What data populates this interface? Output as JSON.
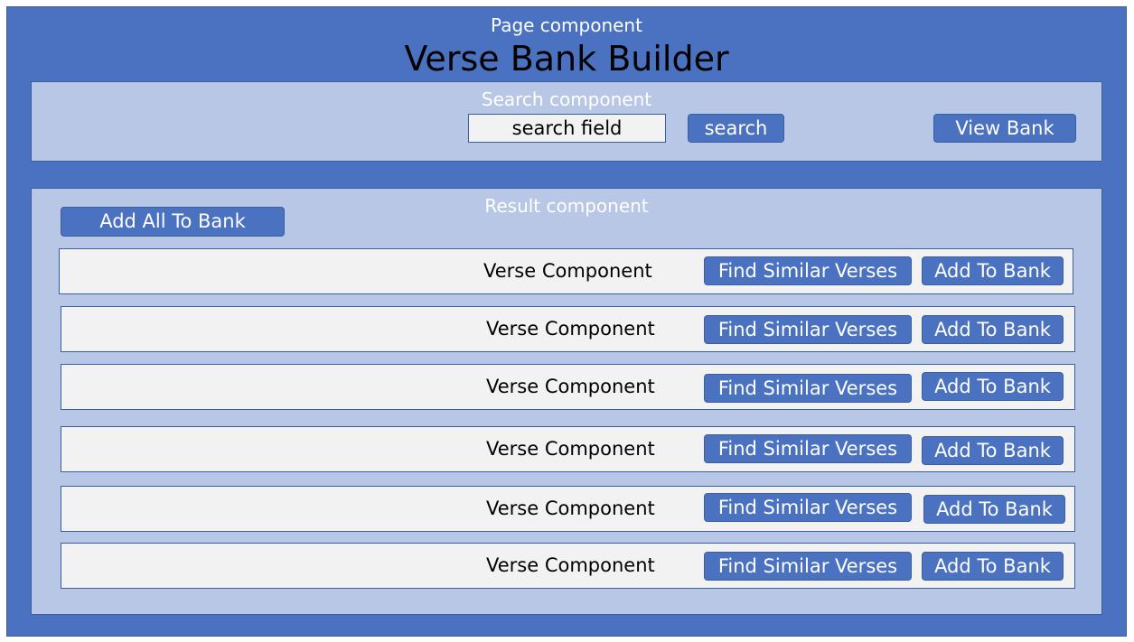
{
  "page": {
    "label": "Page component",
    "title": "Verse Bank Builder"
  },
  "search": {
    "label": "Search component",
    "field_text": "search field",
    "search_button": "search",
    "view_bank_button": "View Bank"
  },
  "result": {
    "label": "Result component",
    "add_all_button": "Add All To Bank",
    "verses": [
      {
        "label": "Verse Component",
        "find_similar": "Find Similar Verses",
        "add": "Add To Bank"
      },
      {
        "label": "Verse Component",
        "find_similar": "Find Similar Verses",
        "add": "Add To Bank"
      },
      {
        "label": "Verse Component",
        "find_similar": "Find Similar Verses",
        "add": "Add To Bank"
      },
      {
        "label": "Verse Component",
        "find_similar": "Find Similar Verses",
        "add": "Add To Bank"
      },
      {
        "label": "Verse Component",
        "find_similar": "Find Similar Verses",
        "add": "Add To Bank"
      },
      {
        "label": "Verse Component",
        "find_similar": "Find Similar Verses",
        "add": "Add To Bank"
      }
    ]
  },
  "colors": {
    "outer_blue": "#4a72c0",
    "inner_light_blue": "#b8c7e5",
    "row_gray": "#f2f2f2"
  }
}
